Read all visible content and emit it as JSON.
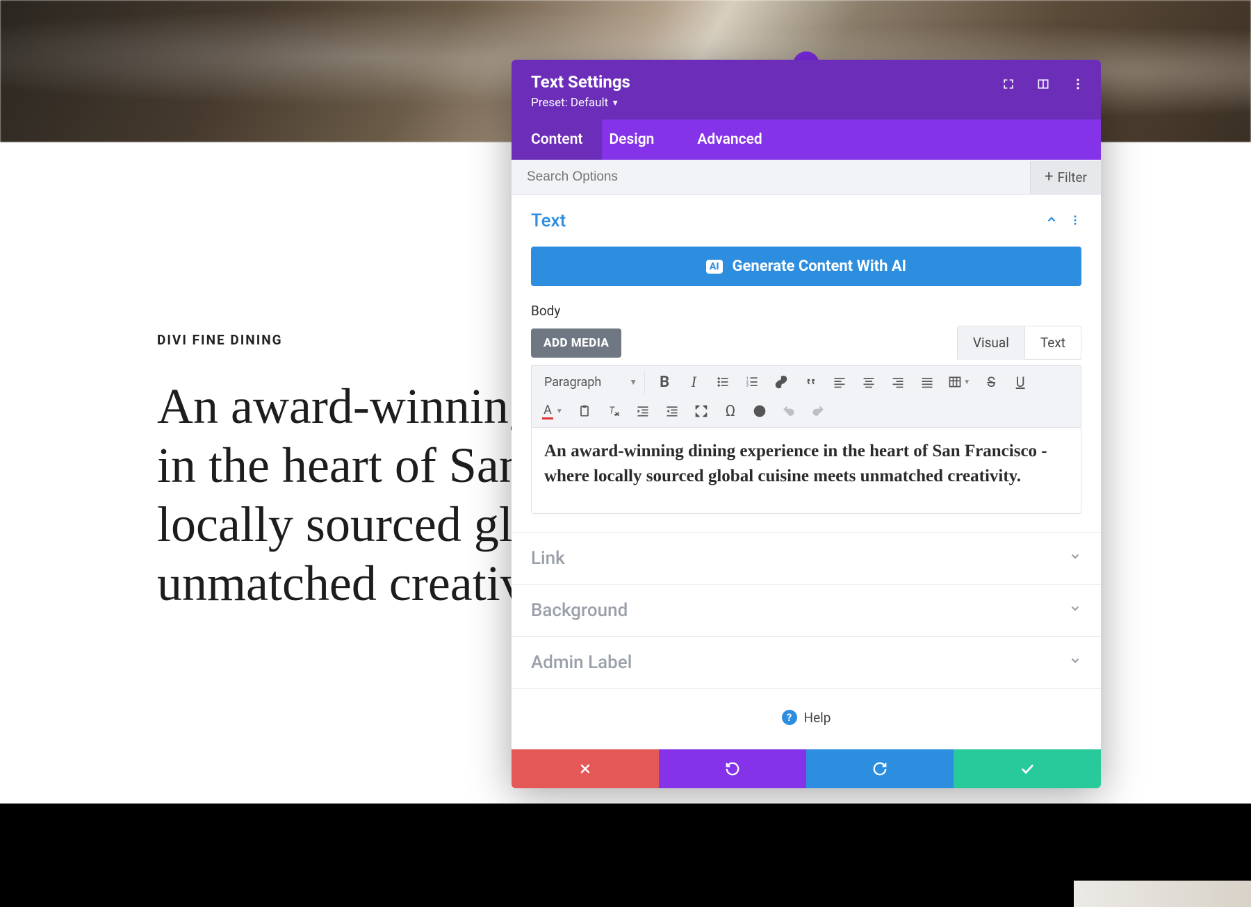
{
  "page": {
    "eyebrow": "DIVI FINE DINING",
    "headline": "An award-winning dining experience in the heart of San Francisco - where locally sourced global cuisine meets unmatched creativity."
  },
  "modal": {
    "title": "Text Settings",
    "preset_label": "Preset:",
    "preset_value": "Default",
    "tabs": [
      "Content",
      "Design",
      "Advanced"
    ],
    "active_tab": "Content",
    "search_placeholder": "Search Options",
    "filter_label": "Filter",
    "sections": {
      "text": {
        "title": "Text",
        "ai_button": "Generate Content With AI",
        "ai_badge": "AI",
        "body_label": "Body",
        "add_media": "ADD MEDIA",
        "mode_visual": "Visual",
        "mode_text": "Text",
        "active_mode": "Visual",
        "paragraph_select": "Paragraph",
        "content": "An award-winning dining experience in the heart of San Francisco - where locally sourced global cuisine meets unmatched creativity."
      },
      "link": {
        "title": "Link"
      },
      "background": {
        "title": "Background"
      },
      "admin_label": {
        "title": "Admin Label"
      }
    },
    "help": "Help"
  },
  "colors": {
    "primary_purple": "#6c2eb9",
    "accent_purple": "#8533e8",
    "blue": "#2d8ee0",
    "teal": "#28c99b",
    "red": "#e45857"
  }
}
